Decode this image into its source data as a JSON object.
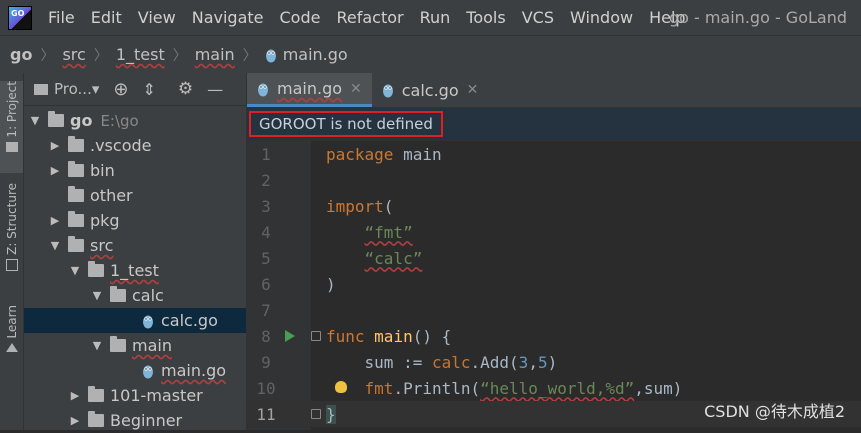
{
  "menu": {
    "items": [
      "File",
      "Edit",
      "View",
      "Navigate",
      "Code",
      "Refactor",
      "Run",
      "Tools",
      "VCS",
      "Window",
      "Help"
    ],
    "window_title": "go - main.go - GoLand"
  },
  "breadcrumbs": [
    "go",
    "src",
    "1_test",
    "main",
    "main.go"
  ],
  "side_tabs": {
    "project": "1: Project",
    "structure": "Z: Structure",
    "learn": "Learn"
  },
  "project_panel": {
    "title": "Pro...▾"
  },
  "tree": [
    {
      "label": "go",
      "sub": "E:\\go"
    },
    {
      "label": ".vscode"
    },
    {
      "label": "bin"
    },
    {
      "label": "other"
    },
    {
      "label": "pkg"
    },
    {
      "label": "src"
    },
    {
      "label": "1_test"
    },
    {
      "label": "calc"
    },
    {
      "label": "calc.go"
    },
    {
      "label": "main"
    },
    {
      "label": "main.go"
    },
    {
      "label": "101-master"
    },
    {
      "label": "Beginner"
    }
  ],
  "tabs": [
    "main.go",
    "calc.go"
  ],
  "banner": "GOROOT is not defined",
  "line_numbers": [
    "1",
    "2",
    "3",
    "4",
    "5",
    "6",
    "7",
    "8",
    "9",
    "10",
    "11"
  ],
  "code": {
    "l1": [
      "package",
      " main"
    ],
    "l3": [
      "import",
      "(",
      ""
    ],
    "l4": [
      "“fmt”"
    ],
    "l5": [
      "“calc”"
    ],
    "l6": [
      ")"
    ],
    "l8": [
      "func",
      " ",
      "main",
      "() {"
    ],
    "l9": [
      "sum := ",
      "calc",
      ".Add(",
      "3",
      ",",
      "5",
      ")"
    ],
    "l10": [
      "fmt",
      ".Println(",
      "“hello_world,%d”",
      ",sum)"
    ],
    "l11": [
      "}"
    ]
  },
  "watermark": "CSDN @待木成植2",
  "colors": {
    "keyword": "#cc7832",
    "string": "#6a8759",
    "number": "#6897bb",
    "banner_border": "#e02020"
  }
}
